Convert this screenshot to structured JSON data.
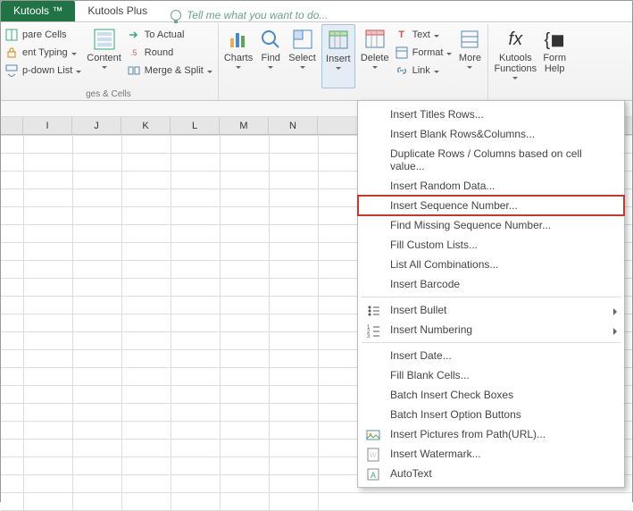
{
  "tabs": {
    "kutools": "Kutools ™",
    "kutoolsPlus": "Kutools Plus"
  },
  "tellMe": "Tell me what you want to do...",
  "ribbon": {
    "leftStack": {
      "compareCells": "pare Cells",
      "preventTyping": "ent Typing",
      "dropdownList": "p-down List"
    },
    "content": "Content",
    "toActual": "To Actual",
    "roundPrefix": ".5",
    "round": "Round",
    "mergeSplit": "Merge & Split",
    "groupLeft": "ges & Cells",
    "charts": "Charts",
    "find": "Find",
    "select": "Select",
    "insert": "Insert",
    "delete": "Delete",
    "text": "Text",
    "format": "Format",
    "link": "Link",
    "more": "More",
    "functions": "Kutools\nFunctions",
    "formulaHelper": "Form\nHelp"
  },
  "columns": [
    "I",
    "J",
    "K",
    "L",
    "M",
    "N"
  ],
  "menu": {
    "items": [
      {
        "t": "Insert Titles Rows...",
        "icon": ""
      },
      {
        "t": "Insert Blank Rows&Columns...",
        "icon": ""
      },
      {
        "t": "Duplicate Rows / Columns based on cell value...",
        "icon": ""
      },
      {
        "t": "Insert Random Data...",
        "icon": ""
      },
      {
        "t": "Insert Sequence Number...",
        "icon": "",
        "hl": true
      },
      {
        "t": "Find Missing Sequence Number...",
        "icon": ""
      },
      {
        "t": "Fill Custom Lists...",
        "icon": ""
      },
      {
        "t": "List All Combinations...",
        "icon": ""
      },
      {
        "t": "Insert Barcode",
        "icon": ""
      },
      {
        "sep": true
      },
      {
        "t": "Insert Bullet",
        "icon": "bullet",
        "sub": true
      },
      {
        "t": "Insert Numbering",
        "icon": "numbering",
        "sub": true
      },
      {
        "sep": true
      },
      {
        "t": "Insert Date...",
        "icon": ""
      },
      {
        "t": "Fill Blank Cells...",
        "icon": ""
      },
      {
        "t": "Batch Insert Check Boxes",
        "icon": ""
      },
      {
        "t": "Batch Insert Option Buttons",
        "icon": ""
      },
      {
        "t": "Insert Pictures from Path(URL)...",
        "icon": "pics"
      },
      {
        "t": "Insert Watermark...",
        "icon": "watermark"
      },
      {
        "t": "AutoText",
        "icon": "autotext"
      }
    ]
  }
}
